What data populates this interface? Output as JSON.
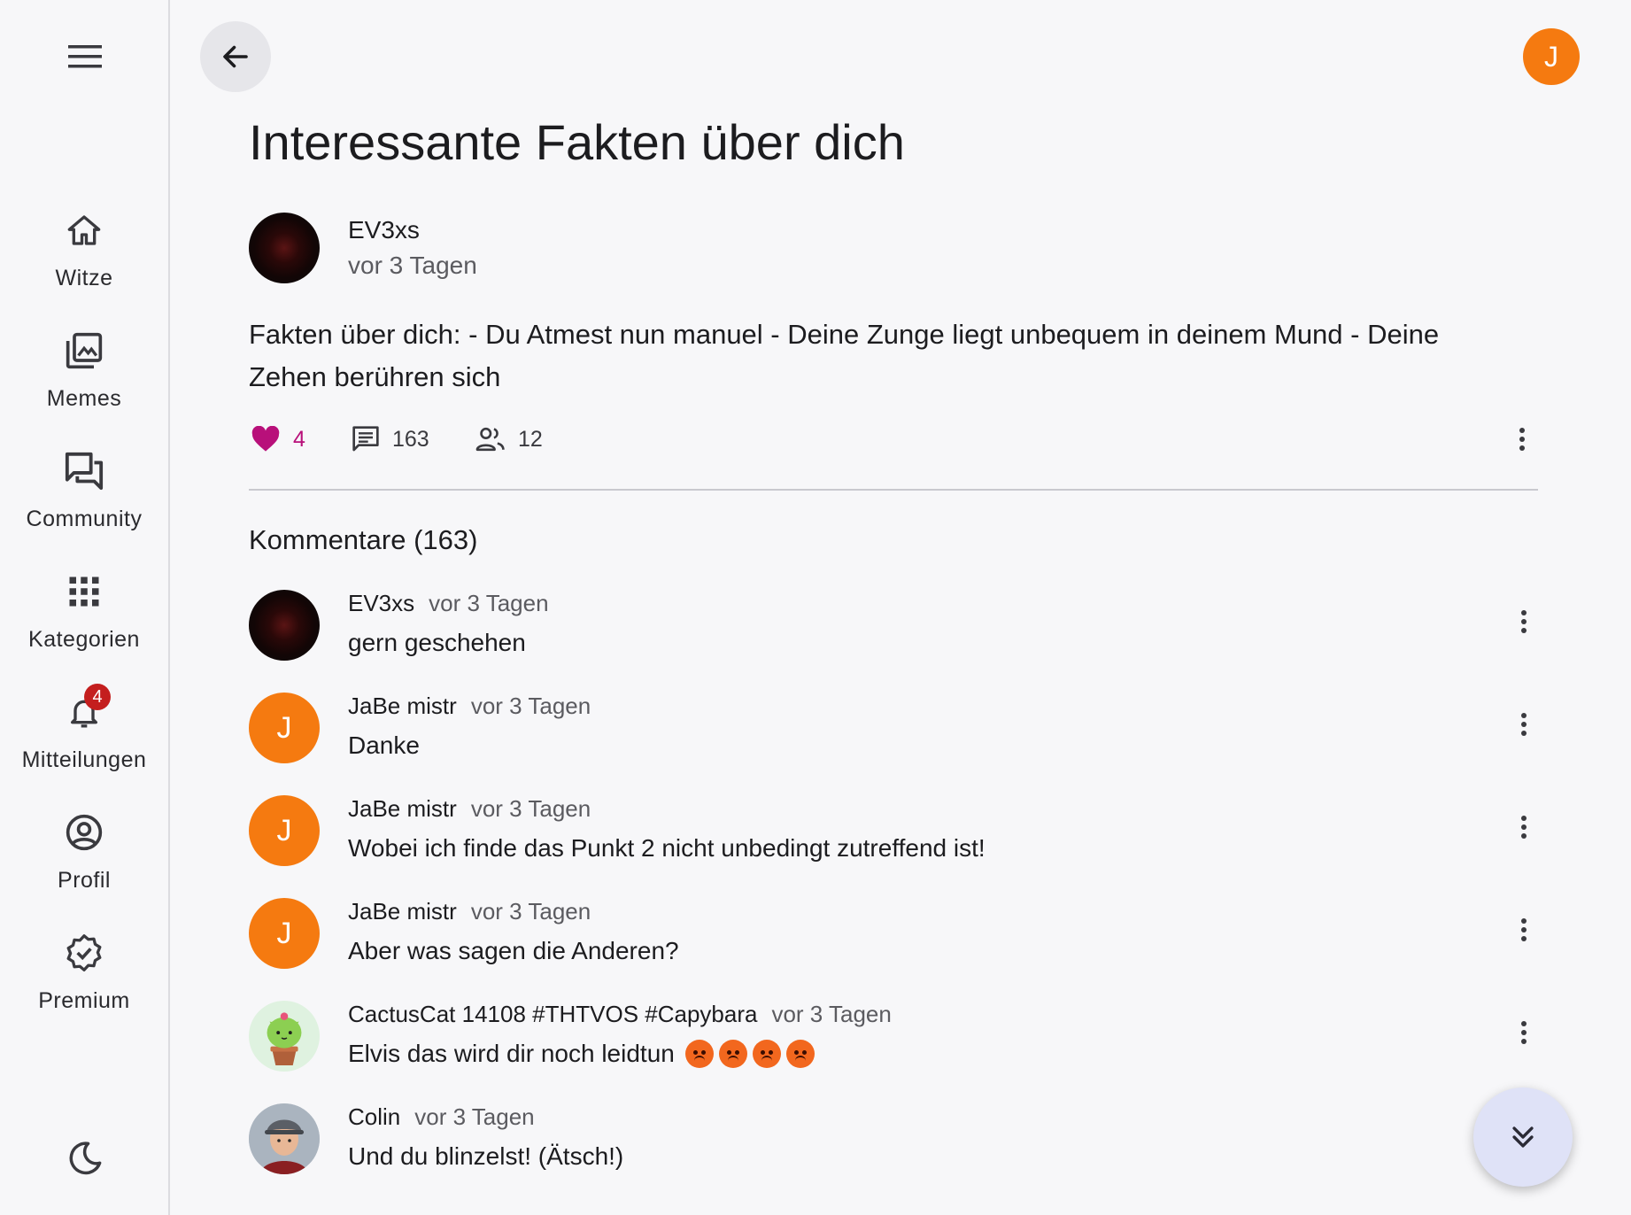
{
  "sidebar": {
    "items": [
      {
        "label": "Witze",
        "icon": "home-icon"
      },
      {
        "label": "Memes",
        "icon": "images-icon"
      },
      {
        "label": "Community",
        "icon": "forum-icon"
      },
      {
        "label": "Kategorien",
        "icon": "apps-grid-icon"
      },
      {
        "label": "Mitteilungen",
        "icon": "bell-icon",
        "badge": "4"
      },
      {
        "label": "Profil",
        "icon": "account-circle-icon"
      },
      {
        "label": "Premium",
        "icon": "verified-badge-icon"
      }
    ]
  },
  "header": {
    "user_initial": "J"
  },
  "post": {
    "title": "Interessante Fakten über dich",
    "author": "EV3xs",
    "time": "vor 3 Tagen",
    "text": "Fakten über dich: - Du Atmest nun manuel - Deine Zunge liegt unbequem in deinem Mund - Deine Zehen berühren sich",
    "likes": "4",
    "comments": "163",
    "participants": "12"
  },
  "comments_title": "Kommentare (163)",
  "comments": [
    {
      "author": "EV3xs",
      "time": "vor 3 Tagen",
      "text": "gern geschehen",
      "avatar": "dark"
    },
    {
      "author": "JaBe mistr",
      "time": "vor 3 Tagen",
      "text": "Danke",
      "avatar": "J"
    },
    {
      "author": "JaBe mistr",
      "time": "vor 3 Tagen",
      "text": "Wobei ich finde das Punkt 2 nicht unbedingt zutreffend ist!",
      "avatar": "J"
    },
    {
      "author": "JaBe mistr",
      "time": "vor 3 Tagen",
      "text": "Aber was sagen die Anderen?",
      "avatar": "J"
    },
    {
      "author": "CactusCat 14108 #THTVOS #Capybara",
      "time": "vor 3 Tagen",
      "text": "Elvis das wird dir noch leidtun",
      "avatar": "cactus",
      "emojis": 4
    },
    {
      "author": "Colin",
      "time": "vor 3 Tagen",
      "text": "Und du blinzelst! (Ätsch!)",
      "avatar": "colin"
    }
  ],
  "colors": {
    "accent": "#f57a10",
    "like": "#b8107a",
    "badge": "#c41e1e",
    "fab": "#dfe2f7"
  }
}
